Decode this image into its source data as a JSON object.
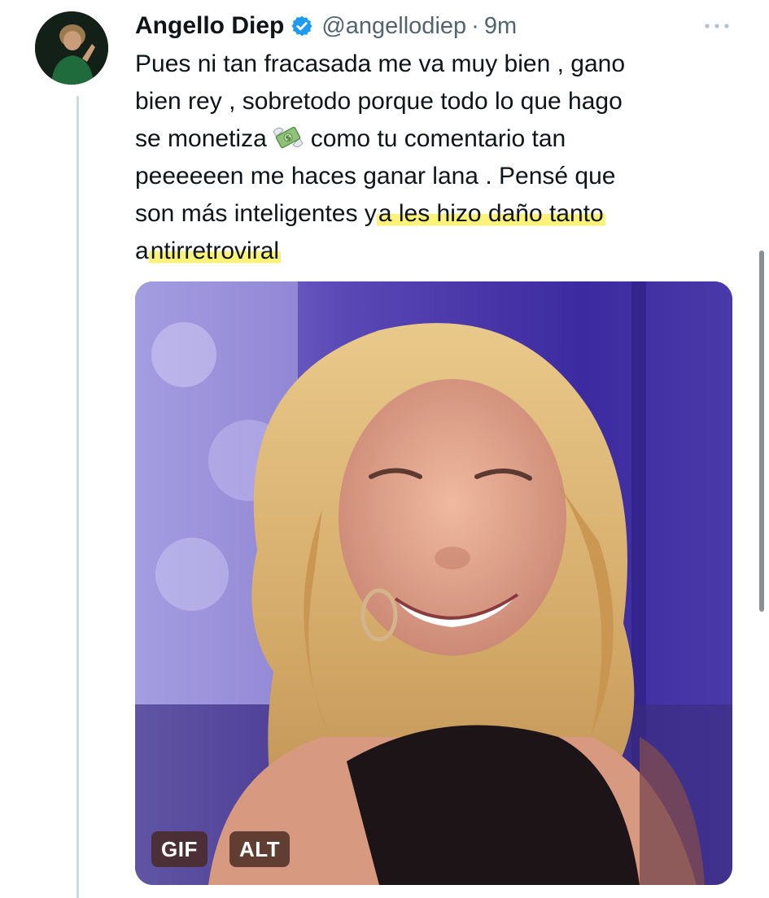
{
  "tweet": {
    "author": {
      "display_name": "Angello Diep",
      "handle": "@angellodiep",
      "verified": true,
      "avatar_icon": "profile-avatar"
    },
    "separator": "·",
    "timestamp": "9m",
    "more_icon": "more-options-icon",
    "text_lines": [
      {
        "segments": [
          {
            "text": "Pues ni tan fracasada me va muy bien , gano"
          }
        ]
      },
      {
        "segments": [
          {
            "text": "bien rey , sobretodo porque todo lo que hago"
          }
        ]
      },
      {
        "segments": [
          {
            "text": "se monetiza"
          },
          {
            "text": "como tu comentario tan"
          }
        ]
      },
      {
        "segments": [
          {
            "text": "peeeeeen me haces ganar lana . Pensé que"
          }
        ]
      },
      {
        "segments": [
          {
            "text": "son más inteligentes y"
          },
          {
            "text": "a les hizo daño tanto",
            "highlight": true
          }
        ]
      },
      {
        "segments": [
          {
            "text": "a"
          },
          {
            "text": "ntirretroviral",
            "highlight": true
          }
        ]
      }
    ],
    "emoji": "money-with-wings-emoji",
    "media": {
      "type": "gif",
      "badges": {
        "gif": "GIF",
        "alt": "ALT"
      }
    }
  },
  "colors": {
    "text_primary": "#0f1419",
    "text_secondary": "#536471",
    "verified_blue": "#1d9bf0",
    "highlight": "#fbf27a",
    "thread_line": "#cfd9de",
    "badge_bg": "#482820"
  }
}
